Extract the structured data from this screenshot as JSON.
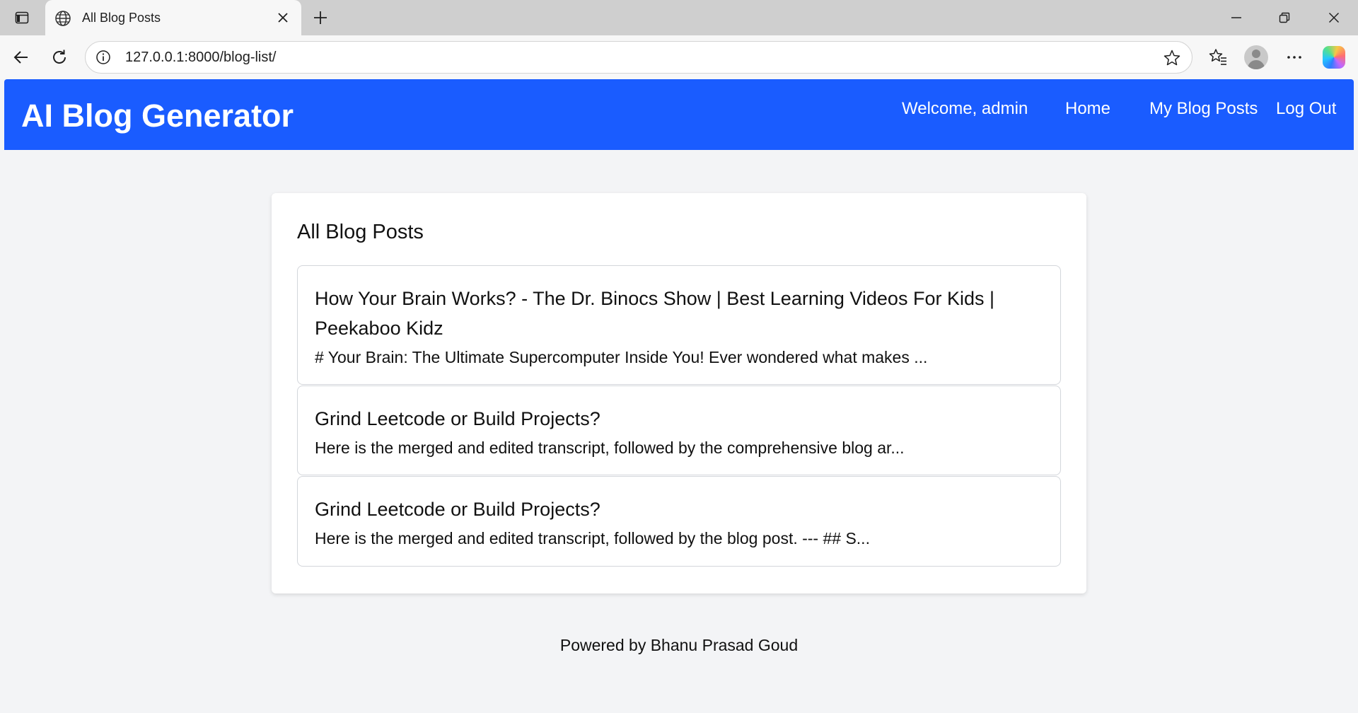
{
  "browser": {
    "tab_title": "All Blog Posts",
    "url": "127.0.0.1:8000/blog-list/",
    "icons": [
      "sidebar-toggle-icon",
      "globe-icon",
      "close-icon",
      "plus-icon",
      "minimize-icon",
      "restore-icon",
      "window-close-icon",
      "back-icon",
      "reload-icon",
      "info-icon",
      "star-icon",
      "favorites-icon",
      "profile-icon",
      "more-icon",
      "copilot-icon"
    ]
  },
  "header": {
    "brand": "AI Blog Generator",
    "welcome": "Welcome, admin",
    "nav": {
      "home": "Home",
      "my_posts": "My Blog Posts",
      "logout": "Log Out"
    },
    "color": "#1a5cff"
  },
  "main": {
    "heading": "All Blog Posts",
    "posts": [
      {
        "title": "How Your Brain Works? - The Dr. Binocs Show | Best Learning Videos For Kids | Peekaboo Kidz",
        "excerpt": "# Your Brain: The Ultimate Supercomputer Inside You! Ever wondered what makes ..."
      },
      {
        "title": "Grind Leetcode or Build Projects?",
        "excerpt": "Here is the merged and edited transcript, followed by the comprehensive blog ar..."
      },
      {
        "title": "Grind Leetcode or Build Projects?",
        "excerpt": "Here is the merged and edited transcript, followed by the blog post. --- ## S..."
      }
    ]
  },
  "footer": {
    "text": "Powered by Bhanu Prasad Goud"
  }
}
